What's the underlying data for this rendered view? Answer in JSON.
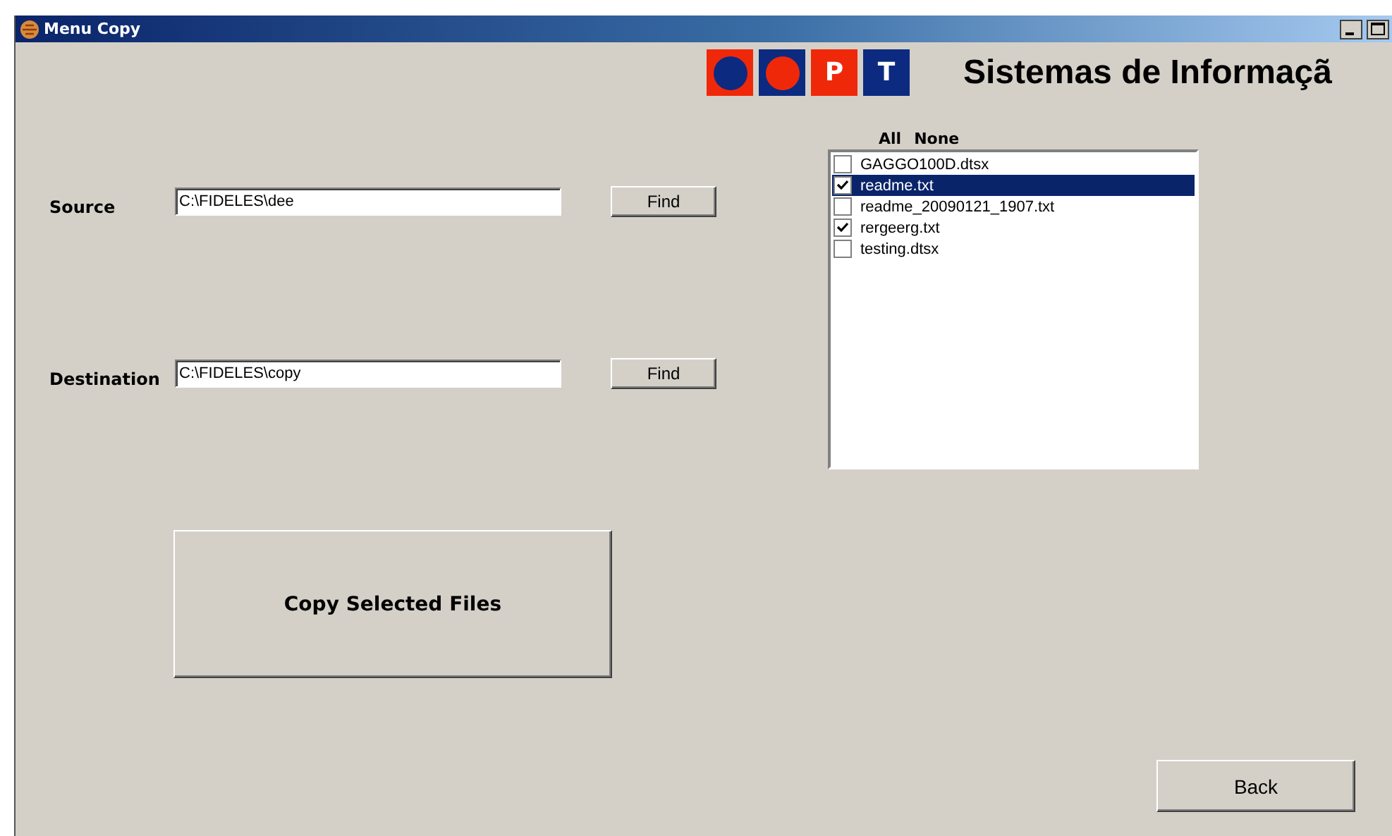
{
  "window": {
    "title": "Menu Copy"
  },
  "header": {
    "logo_letters": [
      "P",
      "T"
    ],
    "title": "Sistemas de Informaçã"
  },
  "source": {
    "label": "Source",
    "value": "C:\\FIDELES\\dee",
    "button": "Find"
  },
  "destination": {
    "label": "Destination",
    "value": "C:\\FIDELES\\copy",
    "button": "Find"
  },
  "file_list": {
    "all_link": "All",
    "none_link": "None",
    "files": [
      {
        "name": "GAGGO100D.dtsx",
        "checked": false,
        "selected": false
      },
      {
        "name": "readme.txt",
        "checked": true,
        "selected": true
      },
      {
        "name": "readme_20090121_1907.txt",
        "checked": false,
        "selected": false
      },
      {
        "name": "rergeerg.txt",
        "checked": true,
        "selected": false
      },
      {
        "name": "testing.dtsx",
        "checked": false,
        "selected": false
      }
    ]
  },
  "copy_button": "Copy Selected Files",
  "back_button": "Back"
}
